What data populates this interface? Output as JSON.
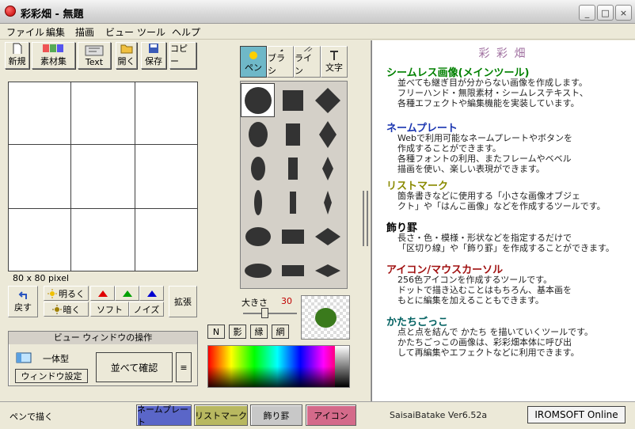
{
  "window": {
    "title": "彩彩畑 - 無題",
    "min": "_",
    "max": "□",
    "close": "×"
  },
  "menu": [
    "ファイル",
    "編集",
    "描画",
    "ビュー",
    "ツール",
    "ヘルプ"
  ],
  "toolbar": {
    "new": "新規",
    "material": "素材集",
    "text": "Text",
    "open": "開く",
    "save": "保存",
    "copy": "コピー"
  },
  "tooltabs": {
    "pen": "ペン",
    "brush": "ブラシ",
    "line": "ライン",
    "char": "文字"
  },
  "canvas": {
    "size_label": "80 x 80 pixel"
  },
  "adjust": {
    "undo": "戻す",
    "bright": "明るく",
    "dark": "暗く",
    "soft": "ソフト",
    "noise": "ノイズ",
    "zoom": "拡張"
  },
  "view": {
    "header": "ビュー ウィンドウの操作",
    "mode": "一体型",
    "settings": "ウィンドウ設定",
    "compare": "並べて確認",
    "menu": "≡"
  },
  "size": {
    "label": "大きさ",
    "value": "30"
  },
  "pen_modes": [
    "N",
    "影",
    "縁",
    "網"
  ],
  "pen_color": "#3a7a1c",
  "info": {
    "logo": "彩 彩 畑",
    "sections": [
      {
        "title": "シームレス画像(メインツール)",
        "color": "#008000",
        "lines": "並べても継ぎ目が分からない画像を作成します。\nフリーハンド・無限素材・シームレステキスト、\n各種エフェクトや編集機能を実装しています。"
      },
      {
        "title": "ネームプレート",
        "color": "#1a35b0",
        "lines": "Webで利用可能なネームプレートやボタンを\n作成することができます。\n各種フォントの利用、またフレームやベベル\n描画を使い、楽しい表現ができます。"
      },
      {
        "title": "リストマーク",
        "color": "#8a8a00",
        "lines": "箇条書きなどに使用する「小さな画像オブジェ\nクト」や「はんこ画像」などを作成するツールです。"
      },
      {
        "title": "飾り罫",
        "color": "#000000",
        "lines": "長さ・色・模様・形状などを指定するだけで\n「区切り線」や「飾り罫」を作成することができます。"
      },
      {
        "title": "アイコン/マウスカーソル",
        "color": "#a01010",
        "lines": "256色アイコンを作成するツールです。\nドットで描き込むことはもちろん、基本画を\nもとに編集を加えることもできます。"
      },
      {
        "title": "かたちごっこ",
        "color": "#006060",
        "lines": "点と点を結んで かたち を描いていくツールです。\nかたちごっこの画像は、彩彩畑本体に呼び出\nして再編集やエフェクトなどに利用できます。"
      }
    ]
  },
  "status": {
    "text": "ペンで描く",
    "tabs": [
      {
        "label": "ネームプレート",
        "color": "#5a66c8"
      },
      {
        "label": "リストマーク",
        "color": "#b8b860"
      },
      {
        "label": "飾り罫",
        "color": "#c8c8c8"
      },
      {
        "label": "アイコン",
        "color": "#d46a8a"
      }
    ],
    "version": "SaisaiBatake Ver6.52a",
    "online": "IROMSOFT Online"
  }
}
